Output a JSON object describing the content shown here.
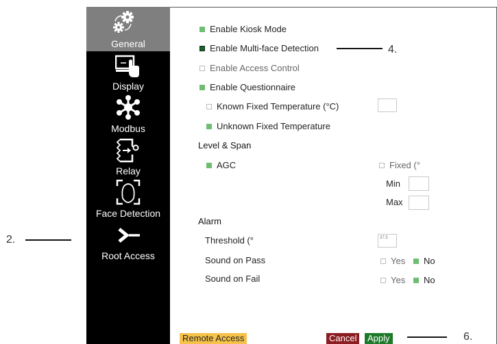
{
  "sidebar": {
    "items": [
      {
        "label": "General",
        "icon": "gears-icon",
        "active": true
      },
      {
        "label": "Display",
        "icon": "display-touch-icon",
        "active": false
      },
      {
        "label": "Modbus",
        "icon": "network-nodes-icon",
        "active": false
      },
      {
        "label": "Relay",
        "icon": "relay-icon",
        "active": false
      },
      {
        "label": "Face Detection",
        "icon": "face-frame-icon",
        "active": false
      },
      {
        "label": "Root Access",
        "icon": "terminal-prompt-icon",
        "active": false
      }
    ]
  },
  "general": {
    "kiosk_mode": "Enable Kiosk Mode",
    "multi_face": "Enable Multi-face Detection",
    "access_control": "Enable Access Control",
    "questionnaire": "Enable Questionnaire",
    "known_temp": "Known Fixed Temperature (°C)",
    "unknown_temp": "Unknown Fixed Temperature"
  },
  "level_span": {
    "title": "Level & Span",
    "agc": "AGC",
    "fixed": "Fixed (°",
    "min_label": "Min",
    "max_label": "Max"
  },
  "alarm": {
    "title": "Alarm",
    "threshold_label": "Threshold (°",
    "threshold_value": "37.5",
    "sound_pass": "Sound on Pass",
    "sound_fail": "Sound on Fail",
    "yes": "Yes",
    "no": "No"
  },
  "footer": {
    "remote_access": "Remote Access",
    "cancel": "Cancel",
    "apply": "Apply"
  },
  "callouts": {
    "two": "2.",
    "four": "4.",
    "six": "6."
  },
  "colors": {
    "active_nav": "#7f7f7f",
    "check_on": "#6ebd72",
    "check_dark": "#0d6a2b",
    "remote": "#f6c24a",
    "cancel": "#8b1c22",
    "apply": "#1d7a2a"
  }
}
